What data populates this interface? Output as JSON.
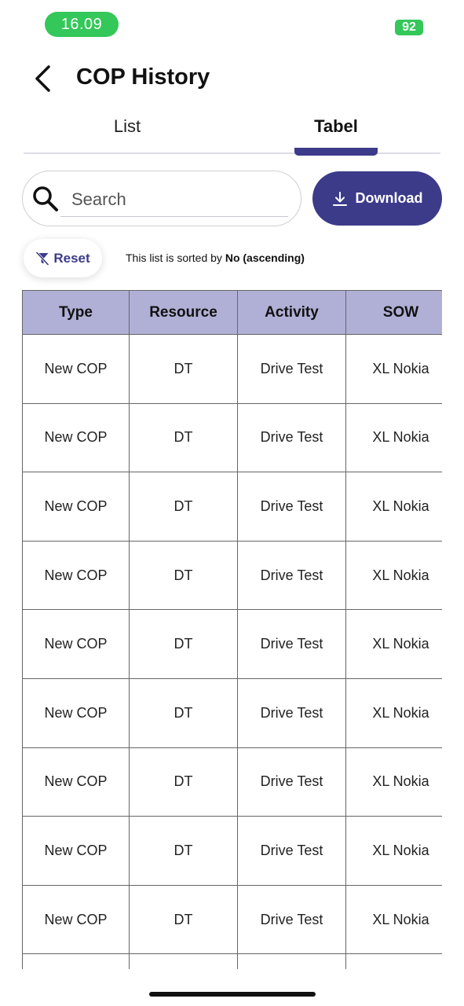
{
  "status_bar": {
    "time": "16.09",
    "battery": "92"
  },
  "header": {
    "title": "COP History"
  },
  "tabs": [
    {
      "label": "List",
      "active": false
    },
    {
      "label": "Tabel",
      "active": true
    }
  ],
  "search": {
    "placeholder": "Search",
    "value": ""
  },
  "download": {
    "label": "Download"
  },
  "reset": {
    "label": "Reset"
  },
  "sort": {
    "prefix": "This list is sorted by ",
    "field": "No (ascending)"
  },
  "table": {
    "columns": [
      "Type",
      "Resource",
      "Activity",
      "SOW"
    ],
    "rows": [
      [
        "New COP",
        "DT",
        "Drive Test",
        "XL Nokia"
      ],
      [
        "New COP",
        "DT",
        "Drive Test",
        "XL Nokia"
      ],
      [
        "New COP",
        "DT",
        "Drive Test",
        "XL Nokia"
      ],
      [
        "New COP",
        "DT",
        "Drive Test",
        "XL Nokia"
      ],
      [
        "New COP",
        "DT",
        "Drive Test",
        "XL Nokia"
      ],
      [
        "New COP",
        "DT",
        "Drive Test",
        "XL Nokia"
      ],
      [
        "New COP",
        "DT",
        "Drive Test",
        "XL Nokia"
      ],
      [
        "New COP",
        "DT",
        "Drive Test",
        "XL Nokia"
      ],
      [
        "New COP",
        "DT",
        "Drive Test",
        "XL Nokia"
      ],
      [
        "",
        "",
        "",
        ""
      ]
    ]
  },
  "colors": {
    "accent": "#3c3b8a",
    "table_header": "#b0b0d6",
    "status_green": "#34c759"
  },
  "icons": {
    "back": "chevron-left-icon",
    "search": "magnifier-icon",
    "download": "download-icon",
    "reset": "filter-off-icon"
  }
}
